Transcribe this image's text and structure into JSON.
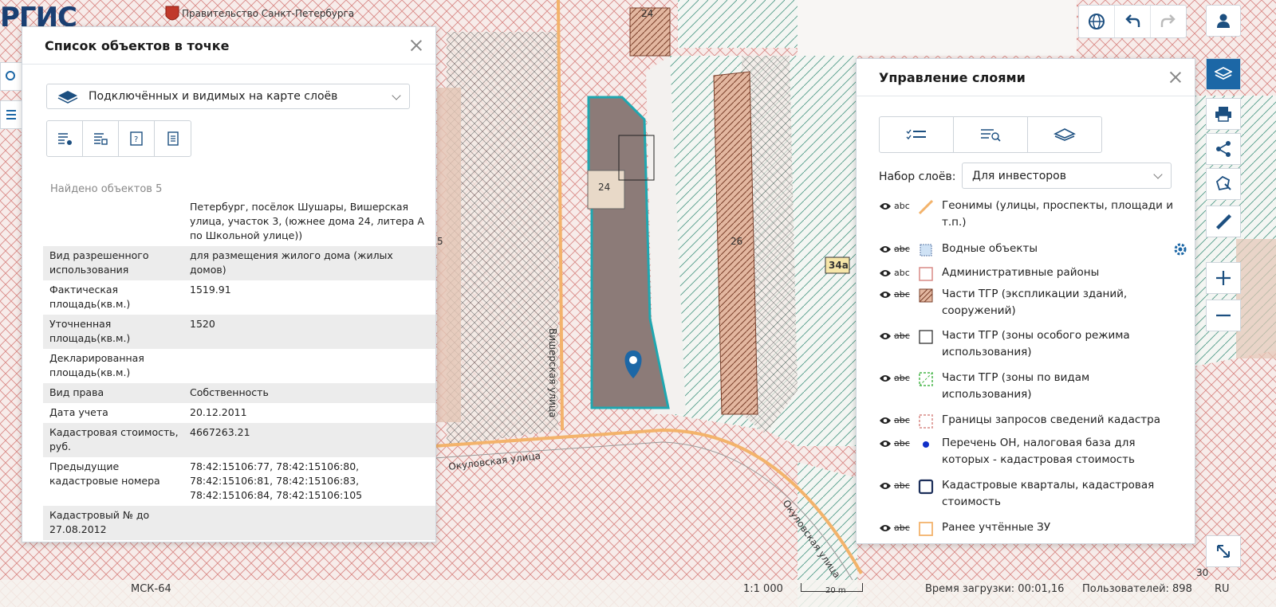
{
  "header": {
    "logo_text": "РГИС",
    "government_text": "Правительство Санкт-Петербурга"
  },
  "objects_panel": {
    "title": "Список объектов в точке",
    "layer_filter": "Подключённых и видимых на карте слоёв",
    "found_text": "Найдено объектов 5",
    "rows": [
      {
        "key": "",
        "value": "Петербург, посёлок Шушары, Вишерская улица, участок 3, (южнее дома 24, литера А по Школьной улице))"
      },
      {
        "key": "Вид разрешенного использования",
        "value": "для размещения жилого дома (жилых домов)"
      },
      {
        "key": "Фактическая площадь(кв.м.)",
        "value": "1519.91"
      },
      {
        "key": "Уточненная площадь(кв.м.)",
        "value": "1520"
      },
      {
        "key": "Декларированная площадь(кв.м.)",
        "value": ""
      },
      {
        "key": "Вид права",
        "value": "Собственность"
      },
      {
        "key": "Дата учета",
        "value": "20.12.2011"
      },
      {
        "key": "Кадастровая стоимость, руб.",
        "value": "4667263.21"
      },
      {
        "key": "Предыдущие кадастровые номера",
        "value": "78:42:15106:77, 78:42:15106:80, 78:42:15106:81, 78:42:15106:83, 78:42:15106:84, 78:42:15106:105"
      },
      {
        "key": "Кадастровый № до 27.08.2012",
        "value": ""
      }
    ]
  },
  "layers_panel": {
    "title": "Управление слоями",
    "set_label": "Набор слоёв:",
    "set_value": "Для инвесторов",
    "layers": [
      {
        "name": "Геонимы (улицы, проспекты, площади и т.п.)",
        "abc": "abc",
        "abc_off": false,
        "symbol": "road"
      },
      {
        "name": "Водные объекты",
        "abc": "abc",
        "abc_off": true,
        "symbol": "water"
      },
      {
        "name": "Административные районы",
        "abc": "abc",
        "abc_off": false,
        "symbol": "admin"
      },
      {
        "name": "Части ТГР (экспликации зданий, сооружений)",
        "abc": "abc",
        "abc_off": true,
        "symbol": "hatch-brown"
      },
      {
        "name": "Части ТГР (зоны особого режима использования)",
        "abc": "abc",
        "abc_off": true,
        "symbol": "black-square"
      },
      {
        "name": "Части ТГР (зоны по видам использования)",
        "abc": "abc",
        "abc_off": true,
        "symbol": "green-dash"
      },
      {
        "name": "Границы запросов сведений кадастра",
        "abc": "abc",
        "abc_off": true,
        "symbol": "red-dash"
      },
      {
        "name": "Перечень ОН, налоговая база для которых - кадастровая стоимость",
        "abc": "abc",
        "abc_off": true,
        "symbol": "blue-dot"
      },
      {
        "name": "Кадастровые кварталы, кадастровая стоимость",
        "abc": "abc",
        "abc_off": true,
        "symbol": "navy-square"
      },
      {
        "name": "Ранее учтённые ЗУ",
        "abc": "abc",
        "abc_off": true,
        "symbol": "orange-square"
      }
    ]
  },
  "map": {
    "street_1": "Вишерская улица",
    "street_2": "Окуловская улица",
    "street_3": "Окуловская улица",
    "house_24_a": "24",
    "house_24_b": "24",
    "house_26": "26",
    "house_34a": "34а",
    "house_30": "30",
    "house_5": "5"
  },
  "statusbar": {
    "crs": "МСК-64",
    "scale": "1:1 000",
    "scalebar_label": "20 m",
    "load_time": "Время загрузки: 00:01,16",
    "users": "Пользователей: 898",
    "lang": "RU"
  },
  "colors": {
    "accent": "#1c67a6",
    "parcel": "#1fa7b0",
    "hatch_red": "#d98a86",
    "hatch_green": "#4f9a86",
    "road": "#f3b36b"
  }
}
